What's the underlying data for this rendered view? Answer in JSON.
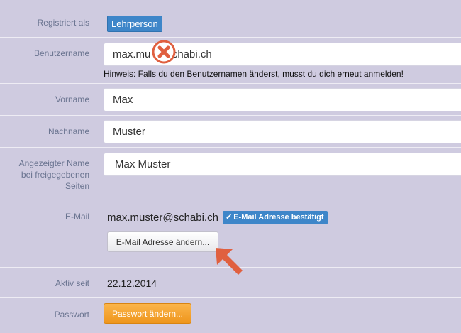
{
  "form": {
    "role": {
      "label": "Registriert als",
      "value": "Lehrperson"
    },
    "username": {
      "label": "Benutzername",
      "value_before": "max.mu",
      "value_after": "schabi.ch",
      "hint": "Hinweis: Falls du den Benutzernamen änderst, musst du dich erneut anmelden!"
    },
    "firstname": {
      "label": "Vorname",
      "value": "Max"
    },
    "lastname": {
      "label": "Nachname",
      "value": "Muster"
    },
    "display_name": {
      "label_lines": [
        "Angezeigter Name",
        "bei freigegebenen",
        "Seiten"
      ],
      "value": "Max Muster"
    },
    "email": {
      "label": "E-Mail",
      "value": "max.muster@schabi.ch",
      "verified_badge": "E-Mail Adresse bestätigt",
      "change_button": "E-Mail Adresse ändern..."
    },
    "active_since": {
      "label": "Aktiv seit",
      "value": "22.12.2014"
    },
    "password": {
      "label": "Passwort",
      "change_button": "Passwort ändern..."
    }
  },
  "colors": {
    "background": "#cfcbe0",
    "accent_blue": "#3e86c9",
    "orange": "#f0a030",
    "annotation_red": "#e06040"
  },
  "icons": {
    "error_overlay": "x-circle-icon",
    "verified": "check-icon",
    "pointer": "arrow-up-left-icon"
  }
}
